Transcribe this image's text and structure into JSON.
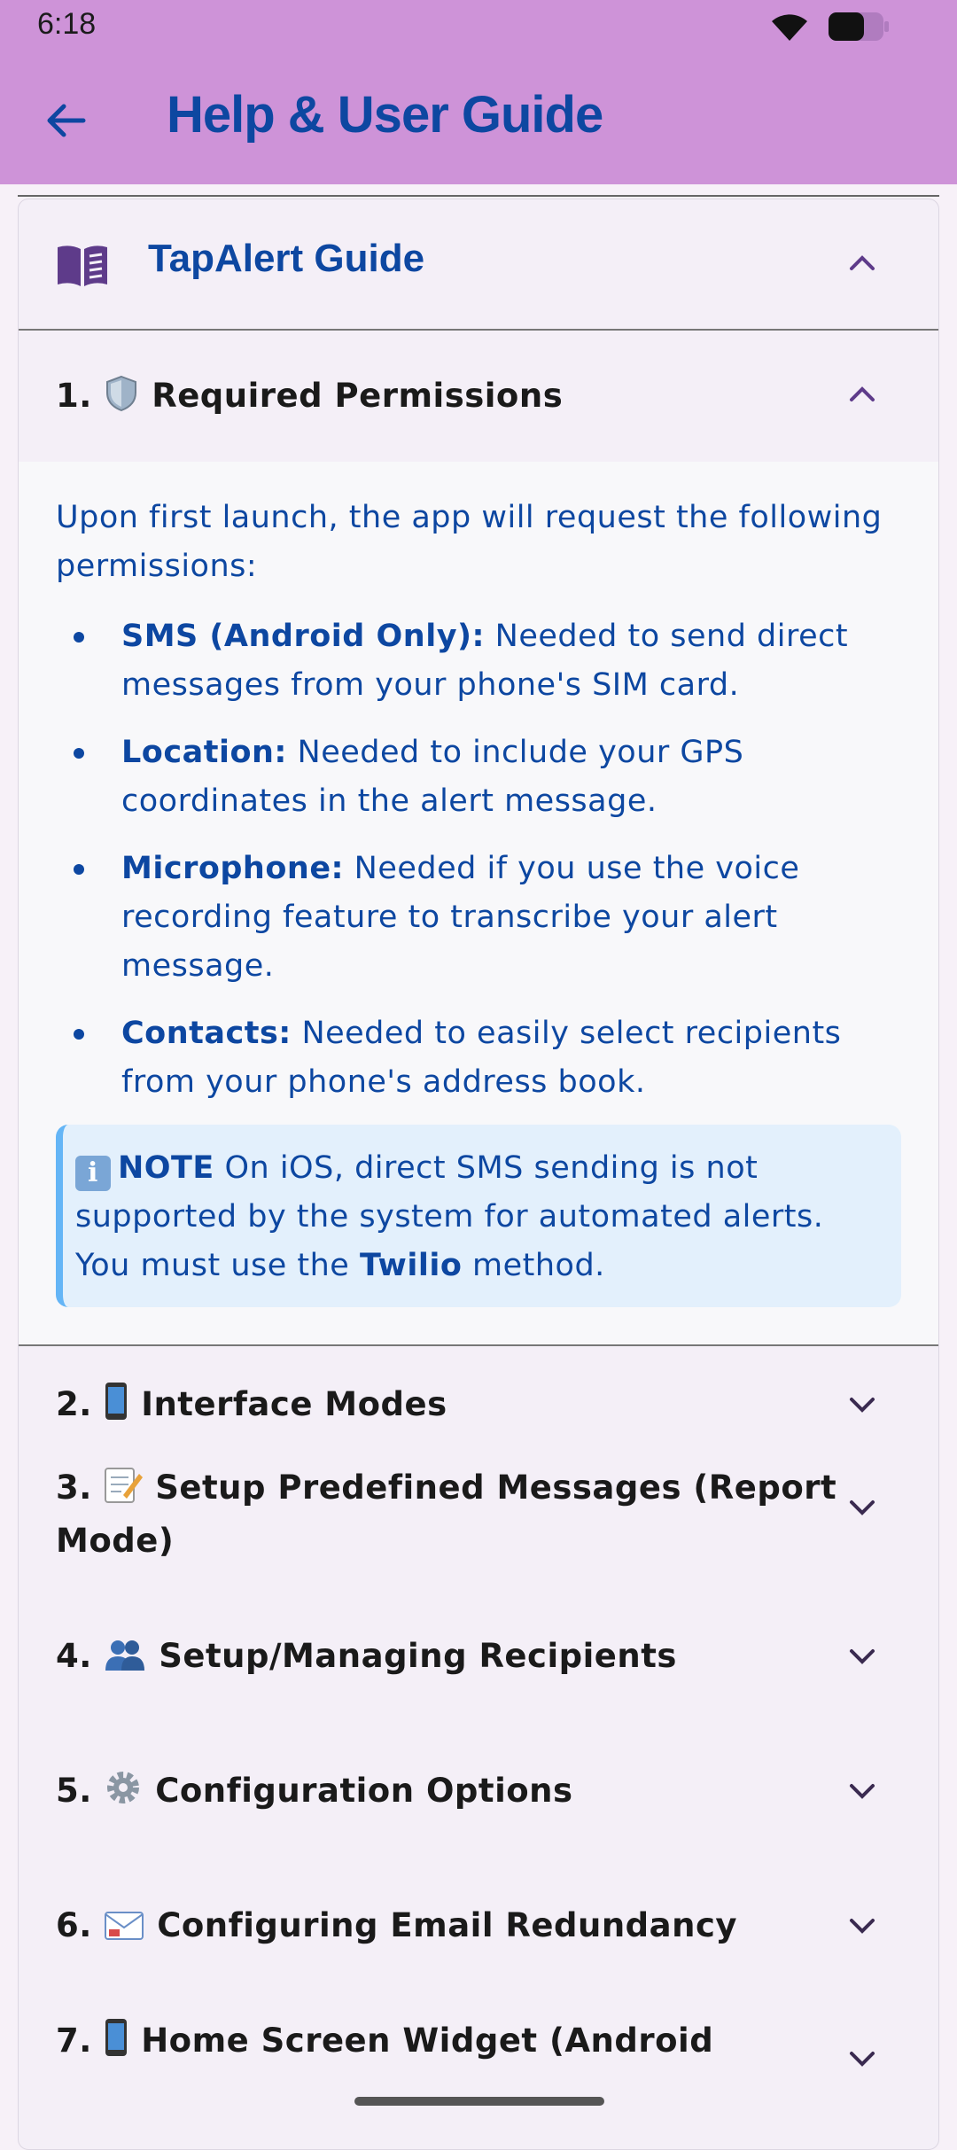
{
  "status": {
    "time": "6:18"
  },
  "header": {
    "title": "Help & User Guide"
  },
  "guide": {
    "title": "TapAlert Guide"
  },
  "sections": [
    {
      "number": "1.",
      "title": "Required Permissions",
      "icon": "shield-icon"
    },
    {
      "number": "2.",
      "title": "Interface Modes",
      "icon": "phone-icon"
    },
    {
      "number": "3.",
      "title": "Setup Predefined Messages (Report",
      "title_line2": "Mode)",
      "icon": "memo-icon"
    },
    {
      "number": "4.",
      "title": "Setup/Managing Recipients",
      "icon": "people-icon"
    },
    {
      "number": "5.",
      "title": "Configuration Options",
      "icon": "gear-icon"
    },
    {
      "number": "6.",
      "title": "Configuring Email Redundancy",
      "icon": "envelope-icon"
    },
    {
      "number": "7.",
      "title": "Home Screen Widget (Android",
      "icon": "phone-icon"
    }
  ],
  "permissions": {
    "intro": "Upon first launch, the app will request the following permissions:",
    "items": [
      {
        "label": "SMS (Android Only):",
        "text": " Needed to send direct messages from your phone's SIM card."
      },
      {
        "label": "Location:",
        "text": " Needed to include your GPS coordinates in the alert message."
      },
      {
        "label": "Microphone:",
        "text": " Needed if you use the voice recording feature to transcribe your alert message."
      },
      {
        "label": "Contacts:",
        "text": " Needed to easily select recipients from your phone's address book."
      }
    ],
    "note": {
      "info_glyph": "i",
      "label": "NOTE",
      "text_before": " On iOS, direct SMS sending is not supported by the system for automated alerts. You must use the ",
      "bold": "Twilio",
      "text_after": " method."
    }
  },
  "colors": {
    "appbar": "#ce93d8",
    "primary_text": "#0d47a1",
    "note_bg": "#e3f0fc",
    "note_border": "#64b5f6",
    "chevron": "#5e3b8a"
  }
}
